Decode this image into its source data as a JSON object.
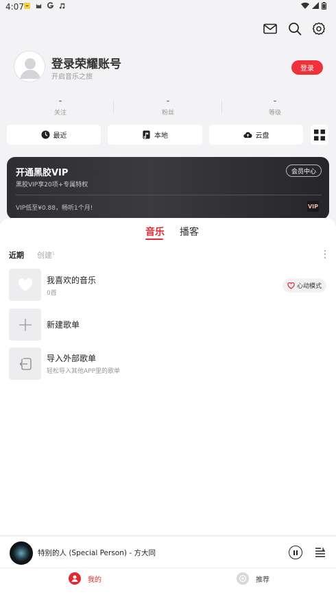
{
  "status_bar": {
    "time": "4:07",
    "left_icons": [
      "notification-badge-icon",
      "cat-app-icon",
      "google-g-icon",
      "music-note-icon"
    ],
    "right_icons": [
      "wifi-icon",
      "signal-icon",
      "battery-icon"
    ]
  },
  "header": {
    "icons": [
      "mail-icon",
      "search-icon",
      "settings-icon"
    ]
  },
  "profile": {
    "title": "登录荣耀账号",
    "subtitle": "开启音乐之旅",
    "login_label": "登录"
  },
  "stats": [
    {
      "value": "-",
      "label": "关注"
    },
    {
      "value": "-",
      "label": "粉丝"
    },
    {
      "value": "-",
      "label": "等级"
    }
  ],
  "quick_actions": [
    {
      "label": "最近",
      "icon": "clock-icon"
    },
    {
      "label": "本地",
      "icon": "music-file-icon"
    },
    {
      "label": "云盘",
      "icon": "cloud-upload-icon"
    }
  ],
  "vip": {
    "title": "开通黑胶VIP",
    "subtitle": "黑胶VIP享20项+专属特权",
    "center_label": "会员中心",
    "promo": "VIP低至¥0.88，畅听1个月!",
    "badge": "VIP"
  },
  "tabs": [
    {
      "label": "音乐",
      "active": true
    },
    {
      "label": "播客",
      "active": false
    }
  ],
  "sub_tabs": {
    "recent": "近期",
    "created": "创建",
    "created_count": "1"
  },
  "playlists": [
    {
      "title": "我喜欢的音乐",
      "subtitle": "0首",
      "icon": "heart-icon"
    },
    {
      "title": "新建歌单",
      "subtitle": "",
      "icon": "plus-icon"
    },
    {
      "title": "导入外部歌单",
      "subtitle": "轻松导入其他APP里的歌单",
      "icon": "import-icon"
    }
  ],
  "heart_mode_label": "心动模式",
  "player": {
    "song": "特别的人 (Special Person) - 方大同"
  },
  "bottom_nav": [
    {
      "label": "我的",
      "active": true
    },
    {
      "label": "推荐",
      "active": false
    }
  ],
  "colors": {
    "accent": "#e5282f",
    "login_button": "#f0303b",
    "background": "#f3f3f5"
  }
}
